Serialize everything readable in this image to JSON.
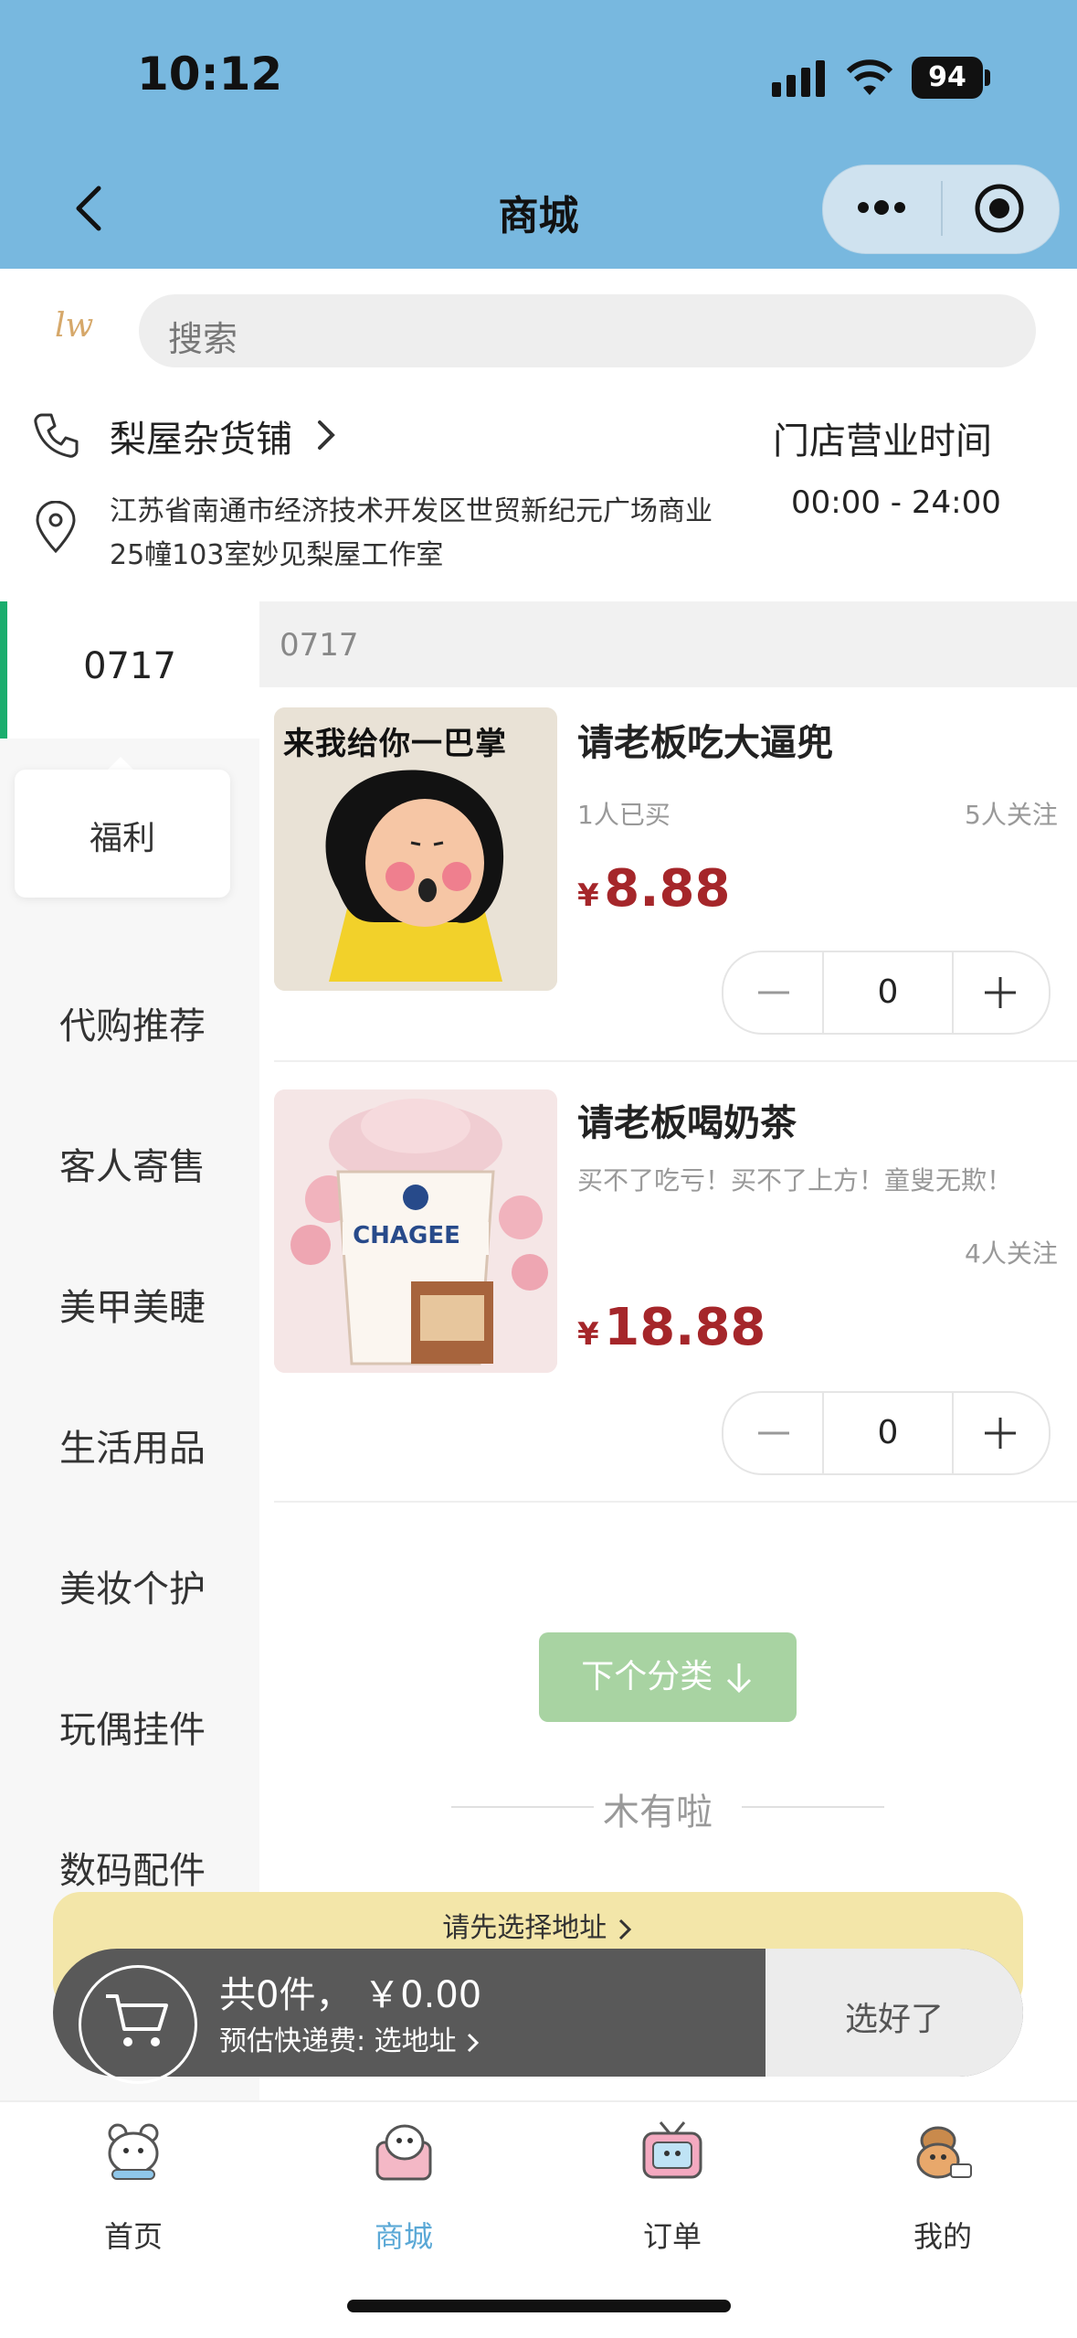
{
  "status_bar": {
    "time": "10:12",
    "battery": "94"
  },
  "header": {
    "title": "商城"
  },
  "search": {
    "logo": "lw",
    "placeholder": "搜索"
  },
  "store": {
    "name": "梨屋杂货铺",
    "hours_label": "门店营业时间",
    "hours_value": "00:00 - 24:00",
    "address": "江苏省南通市经济技术开发区世贸新纪元广场商业25幢103室妙见梨屋工作室"
  },
  "sidebar": {
    "active": "0717",
    "popup": "福利",
    "items": [
      "代购推荐",
      "客人寄售",
      "美甲美睫",
      "生活用品",
      "美妆个护",
      "玩偶挂件",
      "数码配件"
    ]
  },
  "category_header": "0717",
  "products": [
    {
      "image_text": "来我给你一巴掌",
      "title": "请老板吃大逼兜",
      "sold": "1人已买",
      "follow": "5人关注",
      "currency": "¥",
      "price": "8.88",
      "qty": "0"
    },
    {
      "image_text": "CHAGEE",
      "title": "请老板喝奶茶",
      "desc": "买不了吃亏！买不了上方！童叟无欺！",
      "follow": "4人关注",
      "currency": "¥",
      "price": "18.88",
      "qty": "0"
    }
  ],
  "next_category_label": "下个分类",
  "end_text": "木有啦",
  "cart": {
    "address_prompt": "请先选择地址",
    "total": "共0件， ￥0.00",
    "shipping": "预估快递费: 选地址",
    "checkout_label": "选好了"
  },
  "tabbar": {
    "items": [
      {
        "label": "首页",
        "icon": "bear-face-icon"
      },
      {
        "label": "商城",
        "icon": "bear-shop-icon"
      },
      {
        "label": "订单",
        "icon": "tv-bear-icon"
      },
      {
        "label": "我的",
        "icon": "bear-chef-icon"
      }
    ],
    "active_color": "#5aa8d6"
  },
  "colors": {
    "header_bg": "#78b8df",
    "price": "#a5262a",
    "active_indicator": "#1aad6d",
    "next_button": "#a8d3a2"
  }
}
